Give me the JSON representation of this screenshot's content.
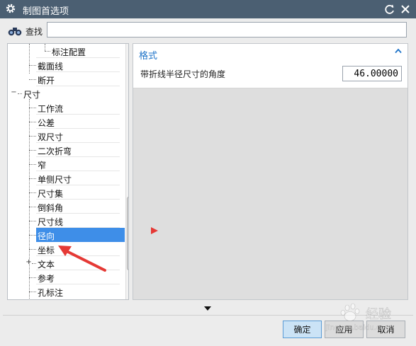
{
  "window": {
    "title": "制图首选项",
    "icons": {
      "app": "gear-icon",
      "reset": "reset-icon",
      "close": "close-icon"
    }
  },
  "search": {
    "label": "查找",
    "value": "",
    "placeholder": "",
    "icon": "binoculars-icon"
  },
  "tree": {
    "items": [
      {
        "label": "标注配置",
        "level": 3,
        "selected": false
      },
      {
        "label": "截面线",
        "level": 2,
        "selected": false
      },
      {
        "label": "断开",
        "level": 2,
        "selected": false
      },
      {
        "label": "尺寸",
        "level": 1,
        "expanded": true,
        "selected": false
      },
      {
        "label": "工作流",
        "level": 2,
        "selected": false
      },
      {
        "label": "公差",
        "level": 2,
        "selected": false
      },
      {
        "label": "双尺寸",
        "level": 2,
        "selected": false
      },
      {
        "label": "二次折弯",
        "level": 2,
        "selected": false
      },
      {
        "label": "窄",
        "level": 2,
        "selected": false
      },
      {
        "label": "单侧尺寸",
        "level": 2,
        "selected": false
      },
      {
        "label": "尺寸集",
        "level": 2,
        "selected": false
      },
      {
        "label": "倒斜角",
        "level": 2,
        "selected": false
      },
      {
        "label": "尺寸线",
        "level": 2,
        "selected": false
      },
      {
        "label": "径向",
        "level": 2,
        "selected": true
      },
      {
        "label": "坐标",
        "level": 2,
        "selected": false
      },
      {
        "label": "文本",
        "level": 2,
        "expanded": false,
        "selected": false
      },
      {
        "label": "参考",
        "level": 2,
        "selected": false
      },
      {
        "label": "孔标注",
        "level": 2,
        "selected": false
      }
    ]
  },
  "panel": {
    "group_title": "格式",
    "collapse_icon": "chevron-up-icon",
    "fields": [
      {
        "label": "带折线半径尺寸的角度",
        "value": "46.00000"
      }
    ]
  },
  "footer": {
    "expand_icon": "chevron-down-icon",
    "ok": "确定",
    "apply": "应用",
    "cancel": "取消"
  },
  "watermark": {
    "text": "经验",
    "domain": "jingyan.baidu.com"
  },
  "colors": {
    "titlebar": "#4b5f72",
    "selection": "#3e8ee8",
    "group_title": "#1e73c8",
    "annotation": "#e53935"
  }
}
